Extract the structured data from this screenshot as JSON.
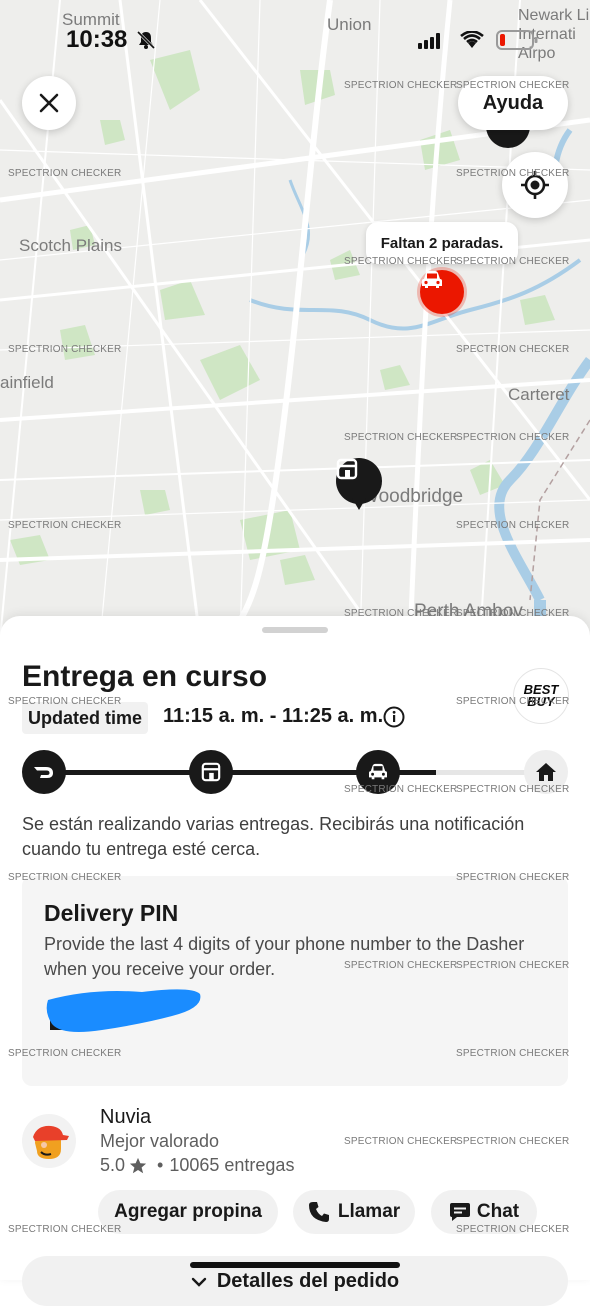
{
  "status_bar": {
    "time": "10:38"
  },
  "map": {
    "labels": {
      "summit": "Summit",
      "union": "Union",
      "newark": "Newark Li\nInternati\nAirpo",
      "scotch_plains": "Scotch Plains",
      "plainfield": "ainfield",
      "carteret": "Carteret",
      "woodbridge": "Woodbridge",
      "perth_amboy": "Perth Amboy"
    },
    "callout": "Faltan 2 paradas.",
    "help_label": "Ayuda"
  },
  "watermark": "SPECTRION CHECKER",
  "sheet": {
    "title": "Entrega en curso",
    "brand_logo": [
      "BEST",
      "BUY"
    ],
    "updated_label": "Updated time",
    "time_range": "11:15 a. m. - 11:25 a. m.",
    "progress_fraction": 0.78,
    "description": "Se están realizando varias entregas. Recibirás una notificación cuando tu entrega esté cerca.",
    "pin_card": {
      "title": "Delivery PIN",
      "description": "Provide the last 4 digits of your phone number to the Dasher when you receive your order."
    },
    "dasher": {
      "name": "Nuvia",
      "badge": "Mejor valorado",
      "rating": "5.0",
      "deliveries": "10065 entregas"
    },
    "actions": {
      "tip": "Agregar propina",
      "call": "Llamar",
      "chat": "Chat"
    },
    "details_label": "Detalles del pedido"
  },
  "colors": {
    "accent_red": "#eb1700",
    "dark": "#191919"
  }
}
